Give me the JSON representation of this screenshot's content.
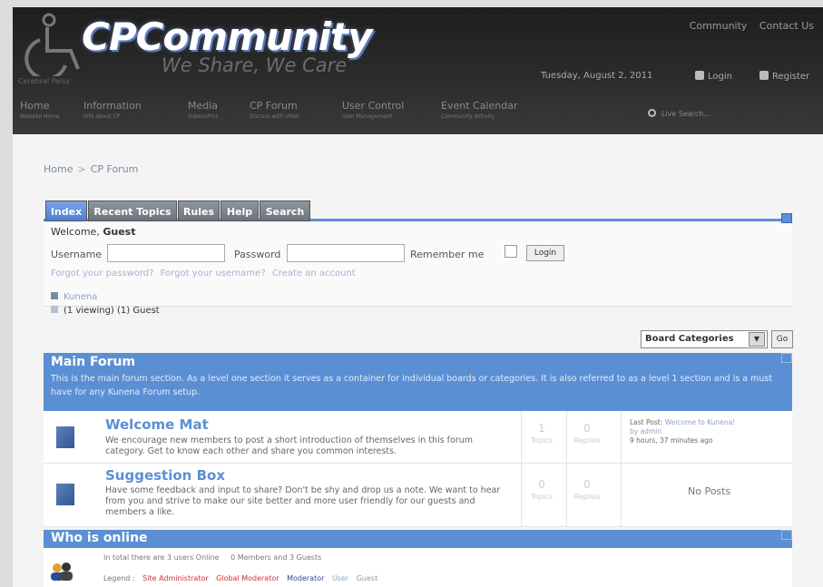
{
  "header": {
    "logo_title": "CPCommunity",
    "logo_tagline": "We Share, We Care",
    "logo_small": "Cerebral Palsy",
    "top_links": [
      "Community",
      "Contact Us"
    ],
    "date": "Tuesday, August 2, 2011",
    "login_label": "Login",
    "register_label": "Register",
    "live_search_placeholder": "Live Search...",
    "nav": [
      {
        "label": "Home",
        "sub": "Website Home"
      },
      {
        "label": "Information",
        "sub": "Info about CP"
      },
      {
        "label": "Media",
        "sub": "Videos/Pics"
      },
      {
        "label": "CP Forum",
        "sub": "Discuss with other"
      },
      {
        "label": "User Control",
        "sub": "User Management"
      },
      {
        "label": "Event Calendar",
        "sub": "Community Activity"
      }
    ]
  },
  "breadcrumb": {
    "home": "Home",
    "sep": ">",
    "current": "CP Forum"
  },
  "tabs": [
    "Index",
    "Recent Topics",
    "Rules",
    "Help",
    "Search"
  ],
  "login": {
    "welcome": "Welcome,",
    "guest": "Guest",
    "username_label": "Username",
    "password_label": "Password",
    "remember_label": "Remember me",
    "login_button": "Login",
    "forgot_password": "Forgot your password?",
    "forgot_username": "Forgot your username?",
    "create_account": "Create an account"
  },
  "stats": {
    "kunena": "Kunena",
    "viewing": "(1 viewing) (1) Guest"
  },
  "category_select": {
    "selected": "Board Categories",
    "go": "Go"
  },
  "main_forum": {
    "title": "Main Forum",
    "description": "This is the main forum section. As a level one section it serves as a container for individual boards or categories. It is also referred to as a level 1 section and is a must have for any Kunena Forum setup."
  },
  "boards": [
    {
      "title": "Welcome Mat",
      "desc": "We encourage new members to post a short introduction of themselves in this forum category. Get to know each other and share you common interests.",
      "topics": "1",
      "topics_label": "Topics",
      "replies": "0",
      "replies_label": "Replies",
      "last_post_label": "Last Post:",
      "last_post_title": "Welcome to Kunena!",
      "last_post_by": "by admin",
      "last_post_time": "9 hours, 37 minutes ago"
    },
    {
      "title": "Suggestion Box",
      "desc": "Have some feedback and input to share? Don't be shy and drop us a note. We want to hear from you and strive to make our site better and more user friendly for our guests and members a like.",
      "topics": "0",
      "topics_label": "Topics",
      "replies": "0",
      "replies_label": "Replies",
      "no_posts": "No Posts"
    }
  ],
  "who_online": {
    "title": "Who is online",
    "total": "In total there are 3 users Online",
    "breakdown": "0 Members and 3 Guests",
    "legend_label": "Legend :",
    "legend": [
      "Site Administrator",
      "Global Moderator",
      "Moderator",
      "User",
      "Guest"
    ],
    "legend_colors": [
      "#c33",
      "#c33",
      "#2a4a9a",
      "#8fa2c5",
      "#999"
    ]
  },
  "colors": {
    "accent": "#5b8fd3",
    "header_bg": "#252525",
    "link": "#8fa2c5"
  }
}
